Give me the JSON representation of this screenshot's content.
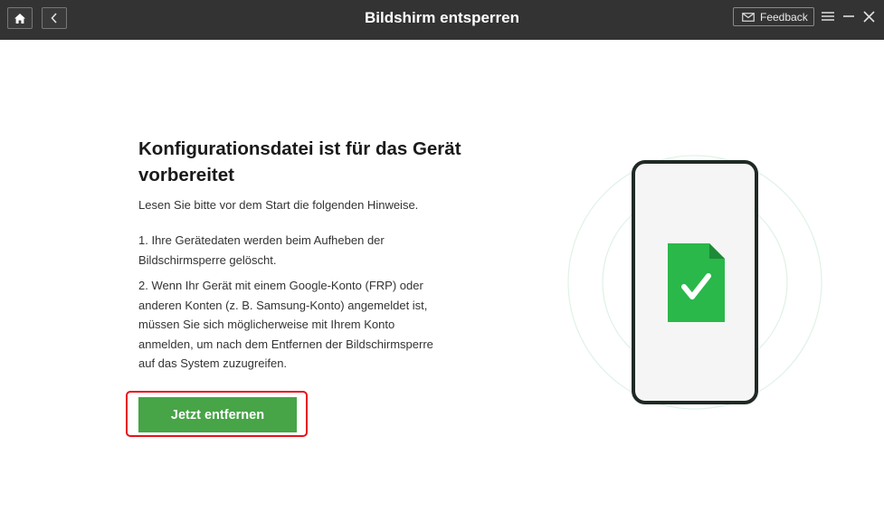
{
  "window": {
    "title": "Bildshirm entsperren",
    "feedback_label": "Feedback"
  },
  "main": {
    "heading": "Konfigurationsdatei ist für das Gerät vorbereitet",
    "intro": "Lesen Sie bitte vor dem Start die folgenden Hinweise.",
    "notes": [
      "1. Ihre Gerätedaten werden beim Aufheben der Bildschirmsperre gelöscht.",
      "2. Wenn Ihr Gerät mit einem Google-Konto (FRP) oder anderen Konten (z. B. Samsung-Konto) angemeldet ist, müssen Sie sich möglicherweise mit Ihrem Konto anmelden, um nach dem Entfernen der Bildschirmsperre auf das System zuzugreifen."
    ],
    "primary_button": "Jetzt entfernen"
  },
  "colors": {
    "titlebar": "#333333",
    "accent_green": "#47a447",
    "highlight_red": "#e8111a",
    "file_green": "#2ab84a"
  },
  "icons": [
    "home-icon",
    "back-arrow-icon",
    "mail-icon",
    "menu-icon",
    "minimize-icon",
    "close-icon",
    "phone-illustration",
    "file-check-icon"
  ]
}
